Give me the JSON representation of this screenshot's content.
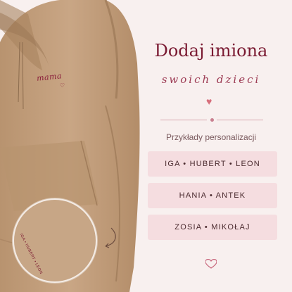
{
  "product": {
    "chest_embroidery": "mama",
    "sleeve_embroidery": "IGA • HUBERT • LEON"
  },
  "panel": {
    "title": "Dodaj imiona",
    "subtitle": "swoich dzieci",
    "section_label": "Przykłady personalizacji",
    "examples": [
      "IGA • HUBERT • LEON",
      "HANIA • ANTEK",
      "ZOSIA • MIKOŁAJ"
    ]
  },
  "colors": {
    "background": "#f8f0ef",
    "hoodie": "#c8a585",
    "accent": "#7a1a32",
    "card": "#f5dde0",
    "heart": "#d76f7c"
  },
  "icons": [
    "heart-icon",
    "arrow-icon"
  ]
}
